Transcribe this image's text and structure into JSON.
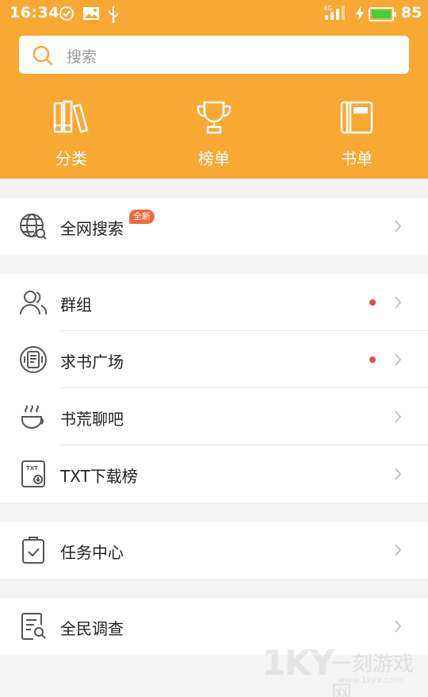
{
  "status_bar": {
    "time": "16:34",
    "signal": "4G",
    "battery_percent": "85"
  },
  "search": {
    "placeholder": "搜索"
  },
  "top_nav": [
    {
      "label": "分类",
      "icon": "books-icon"
    },
    {
      "label": "榜单",
      "icon": "trophy-icon"
    },
    {
      "label": "书单",
      "icon": "booklist-icon"
    }
  ],
  "sections": [
    {
      "items": [
        {
          "label": "全网搜索",
          "icon": "globe-search-icon",
          "badge": "全新"
        }
      ]
    },
    {
      "items": [
        {
          "label": "群组",
          "icon": "group-icon",
          "dot": true
        },
        {
          "label": "求书广场",
          "icon": "book-request-icon",
          "dot": true
        },
        {
          "label": "书荒聊吧",
          "icon": "coffee-cup-icon"
        },
        {
          "label": "TXT下载榜",
          "icon": "txt-download-icon"
        }
      ]
    },
    {
      "items": [
        {
          "label": "任务中心",
          "icon": "task-clipboard-icon"
        }
      ]
    },
    {
      "items": [
        {
          "label": "全民调查",
          "icon": "survey-icon"
        }
      ]
    }
  ],
  "watermark": {
    "logo": "1KY",
    "title": "一刻游戏网",
    "url": "www.1kyx.com"
  },
  "colors": {
    "header": "#f9a833",
    "accent_icon": "#f9a833",
    "badge": "#f06a3a",
    "dot": "#e0504a",
    "background": "#f4f4f4"
  }
}
